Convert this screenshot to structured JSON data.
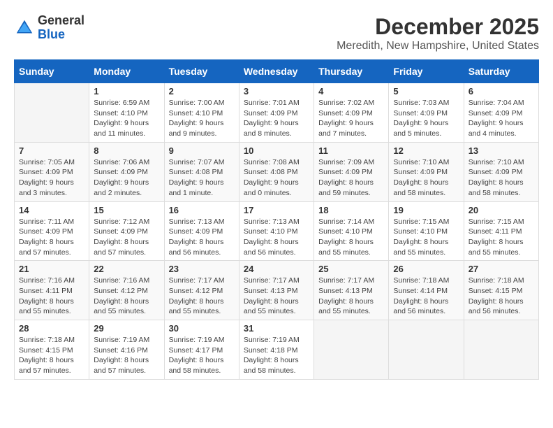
{
  "header": {
    "logo_general": "General",
    "logo_blue": "Blue",
    "month_title": "December 2025",
    "location": "Meredith, New Hampshire, United States"
  },
  "calendar": {
    "days_of_week": [
      "Sunday",
      "Monday",
      "Tuesday",
      "Wednesday",
      "Thursday",
      "Friday",
      "Saturday"
    ],
    "weeks": [
      [
        {
          "day": "",
          "info": ""
        },
        {
          "day": "1",
          "info": "Sunrise: 6:59 AM\nSunset: 4:10 PM\nDaylight: 9 hours\nand 11 minutes."
        },
        {
          "day": "2",
          "info": "Sunrise: 7:00 AM\nSunset: 4:10 PM\nDaylight: 9 hours\nand 9 minutes."
        },
        {
          "day": "3",
          "info": "Sunrise: 7:01 AM\nSunset: 4:09 PM\nDaylight: 9 hours\nand 8 minutes."
        },
        {
          "day": "4",
          "info": "Sunrise: 7:02 AM\nSunset: 4:09 PM\nDaylight: 9 hours\nand 7 minutes."
        },
        {
          "day": "5",
          "info": "Sunrise: 7:03 AM\nSunset: 4:09 PM\nDaylight: 9 hours\nand 5 minutes."
        },
        {
          "day": "6",
          "info": "Sunrise: 7:04 AM\nSunset: 4:09 PM\nDaylight: 9 hours\nand 4 minutes."
        }
      ],
      [
        {
          "day": "7",
          "info": "Sunrise: 7:05 AM\nSunset: 4:09 PM\nDaylight: 9 hours\nand 3 minutes."
        },
        {
          "day": "8",
          "info": "Sunrise: 7:06 AM\nSunset: 4:09 PM\nDaylight: 9 hours\nand 2 minutes."
        },
        {
          "day": "9",
          "info": "Sunrise: 7:07 AM\nSunset: 4:08 PM\nDaylight: 9 hours\nand 1 minute."
        },
        {
          "day": "10",
          "info": "Sunrise: 7:08 AM\nSunset: 4:08 PM\nDaylight: 9 hours\nand 0 minutes."
        },
        {
          "day": "11",
          "info": "Sunrise: 7:09 AM\nSunset: 4:09 PM\nDaylight: 8 hours\nand 59 minutes."
        },
        {
          "day": "12",
          "info": "Sunrise: 7:10 AM\nSunset: 4:09 PM\nDaylight: 8 hours\nand 58 minutes."
        },
        {
          "day": "13",
          "info": "Sunrise: 7:10 AM\nSunset: 4:09 PM\nDaylight: 8 hours\nand 58 minutes."
        }
      ],
      [
        {
          "day": "14",
          "info": "Sunrise: 7:11 AM\nSunset: 4:09 PM\nDaylight: 8 hours\nand 57 minutes."
        },
        {
          "day": "15",
          "info": "Sunrise: 7:12 AM\nSunset: 4:09 PM\nDaylight: 8 hours\nand 57 minutes."
        },
        {
          "day": "16",
          "info": "Sunrise: 7:13 AM\nSunset: 4:09 PM\nDaylight: 8 hours\nand 56 minutes."
        },
        {
          "day": "17",
          "info": "Sunrise: 7:13 AM\nSunset: 4:10 PM\nDaylight: 8 hours\nand 56 minutes."
        },
        {
          "day": "18",
          "info": "Sunrise: 7:14 AM\nSunset: 4:10 PM\nDaylight: 8 hours\nand 55 minutes."
        },
        {
          "day": "19",
          "info": "Sunrise: 7:15 AM\nSunset: 4:10 PM\nDaylight: 8 hours\nand 55 minutes."
        },
        {
          "day": "20",
          "info": "Sunrise: 7:15 AM\nSunset: 4:11 PM\nDaylight: 8 hours\nand 55 minutes."
        }
      ],
      [
        {
          "day": "21",
          "info": "Sunrise: 7:16 AM\nSunset: 4:11 PM\nDaylight: 8 hours\nand 55 minutes."
        },
        {
          "day": "22",
          "info": "Sunrise: 7:16 AM\nSunset: 4:12 PM\nDaylight: 8 hours\nand 55 minutes."
        },
        {
          "day": "23",
          "info": "Sunrise: 7:17 AM\nSunset: 4:12 PM\nDaylight: 8 hours\nand 55 minutes."
        },
        {
          "day": "24",
          "info": "Sunrise: 7:17 AM\nSunset: 4:13 PM\nDaylight: 8 hours\nand 55 minutes."
        },
        {
          "day": "25",
          "info": "Sunrise: 7:17 AM\nSunset: 4:13 PM\nDaylight: 8 hours\nand 55 minutes."
        },
        {
          "day": "26",
          "info": "Sunrise: 7:18 AM\nSunset: 4:14 PM\nDaylight: 8 hours\nand 56 minutes."
        },
        {
          "day": "27",
          "info": "Sunrise: 7:18 AM\nSunset: 4:15 PM\nDaylight: 8 hours\nand 56 minutes."
        }
      ],
      [
        {
          "day": "28",
          "info": "Sunrise: 7:18 AM\nSunset: 4:15 PM\nDaylight: 8 hours\nand 57 minutes."
        },
        {
          "day": "29",
          "info": "Sunrise: 7:19 AM\nSunset: 4:16 PM\nDaylight: 8 hours\nand 57 minutes."
        },
        {
          "day": "30",
          "info": "Sunrise: 7:19 AM\nSunset: 4:17 PM\nDaylight: 8 hours\nand 58 minutes."
        },
        {
          "day": "31",
          "info": "Sunrise: 7:19 AM\nSunset: 4:18 PM\nDaylight: 8 hours\nand 58 minutes."
        },
        {
          "day": "",
          "info": ""
        },
        {
          "day": "",
          "info": ""
        },
        {
          "day": "",
          "info": ""
        }
      ]
    ]
  }
}
